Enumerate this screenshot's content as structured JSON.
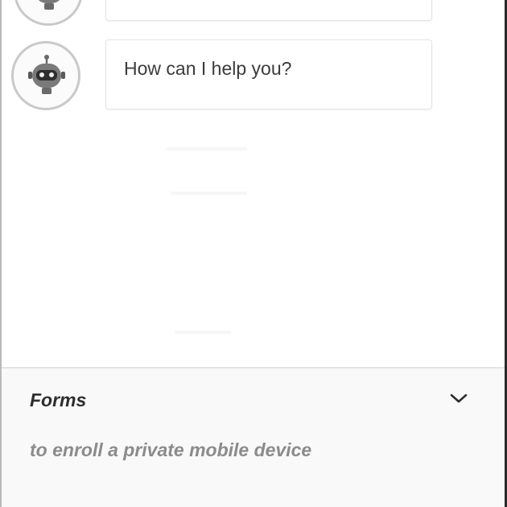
{
  "chat": {
    "messages": [
      {
        "sender": "bot",
        "avatar_icon": "robot-icon",
        "text": ""
      },
      {
        "sender": "bot",
        "avatar_icon": "robot-icon",
        "text": "How can I help you?"
      }
    ]
  },
  "forms": {
    "title": "Forms",
    "toggle_icon": "chevron-down-icon",
    "items": [
      {
        "label": "to enroll a private mobile device"
      },
      {
        "label": ""
      }
    ]
  },
  "colors": {
    "panel_background": "#f9f9f9",
    "text_primary": "#3b3b3b",
    "text_muted": "#8b8b8b",
    "avatar_border": "#c9c9c9"
  }
}
